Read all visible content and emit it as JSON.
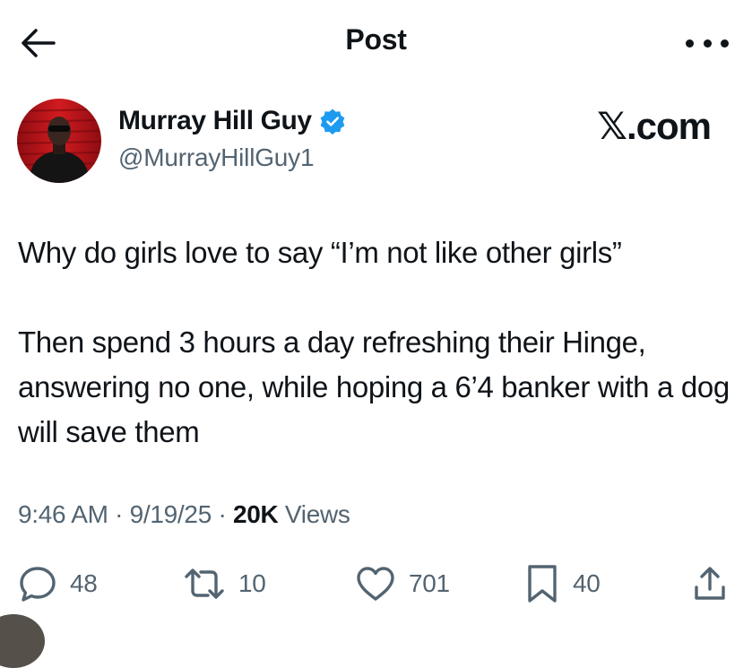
{
  "header": {
    "title": "Post",
    "back_icon": "arrow-left-icon",
    "more_icon": "more-horizontal-icon"
  },
  "author": {
    "name": "Murray Hill Guy",
    "handle": "@MurrayHillGuy1",
    "verified": true,
    "verified_color": "#1d9bf0",
    "avatar_bg_color": "#c4161c"
  },
  "watermark": "𝕏.com",
  "tweet": {
    "paragraphs": [
      "Why do girls love to say “I’m not like other girls”",
      "Then spend 3 hours a day refreshing their Hinge, answering no one, while hoping a 6’4 banker with a dog will save them"
    ]
  },
  "meta": {
    "time": "9:46 AM",
    "separator": "·",
    "date": "9/19/25",
    "views_count": "20K",
    "views_label": "Views"
  },
  "actions": {
    "replies": "48",
    "reposts": "10",
    "likes": "701",
    "bookmarks": "40"
  },
  "colors": {
    "text_primary": "#0f1419",
    "text_secondary": "#536471",
    "background": "#ffffff"
  }
}
